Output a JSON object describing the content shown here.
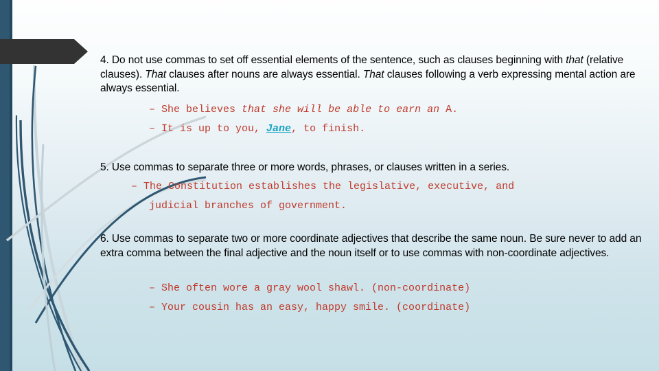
{
  "slide": {
    "background_top_color": "#fefefe",
    "background_bottom_color": "#c6dfe7",
    "accent_bar_color": "#2f5771",
    "banner_color": "#333333",
    "body_text_color": "#000000",
    "example_text_color": "#C0392B",
    "highlight_name_color": "#17A3C4"
  },
  "rules": [
    {
      "id": "rule-4",
      "paragraph_parts": [
        {
          "text": "4. Do not use commas to set off essential elements of the sentence, such as clauses beginning with ",
          "italic": false
        },
        {
          "text": "that",
          "italic": true
        },
        {
          "text": " (relative clauses). ",
          "italic": false
        },
        {
          "text": "That",
          "italic": true
        },
        {
          "text": " clauses after nouns are always essential. ",
          "italic": false
        },
        {
          "text": "That",
          "italic": true
        },
        {
          "text": " clauses following a verb expressing mental action are always essential.",
          "italic": false
        }
      ],
      "plain_paragraph": "4. Do not use commas to set off essential elements of the sentence, such as clauses beginning with that (relative clauses). That clauses after nouns are always essential. That clauses following a verb expressing mental action are always essential.",
      "examples": [
        {
          "dash": "–",
          "parts": [
            {
              "text": "She believes ",
              "style": "plain"
            },
            {
              "text": "that she will be able to earn an",
              "style": "italic"
            },
            {
              "text": " A.",
              "style": "plain"
            }
          ],
          "plain": "– She believes that she will be able to earn an A."
        },
        {
          "dash": "–",
          "parts": [
            {
              "text": "It is up to you, ",
              "style": "plain"
            },
            {
              "text": "Jane",
              "style": "highlight"
            },
            {
              "text": ", to finish.",
              "style": "plain"
            }
          ],
          "plain": "– It is up to you, Jane, to finish."
        }
      ]
    },
    {
      "id": "rule-5",
      "paragraph_parts": [
        {
          "text": "5. Use commas to separate three or more words, phrases, or clauses written in a series.",
          "italic": false
        }
      ],
      "plain_paragraph": "5. Use commas to separate three or more words, phrases, or clauses written in a series.",
      "examples": [
        {
          "dash": "–",
          "line1": "– The Constitution establishes the legislative, executive, and",
          "line2": "judicial branches of government.",
          "plain": "– The Constitution establishes the legislative, executive, and judicial branches of government."
        }
      ]
    },
    {
      "id": "rule-6",
      "paragraph_parts": [
        {
          "text": "6. Use commas to separate two or more coordinate adjectives that describe the same noun. Be sure never to add an extra comma between the final adjective and the noun itself or to use commas with non-coordinate adjectives.",
          "italic": false
        }
      ],
      "plain_paragraph": "6. Use commas to separate two or more coordinate adjectives that describe the same noun. Be sure never to add an extra comma between the final adjective and the noun itself or to use commas with non-coordinate adjectives.",
      "examples": [
        {
          "dash": "–",
          "plain": "– She often wore a gray wool shawl. (non-coordinate)"
        },
        {
          "dash": "–",
          "plain": "– Your cousin has an easy, happy smile. (coordinate)"
        }
      ]
    }
  ]
}
